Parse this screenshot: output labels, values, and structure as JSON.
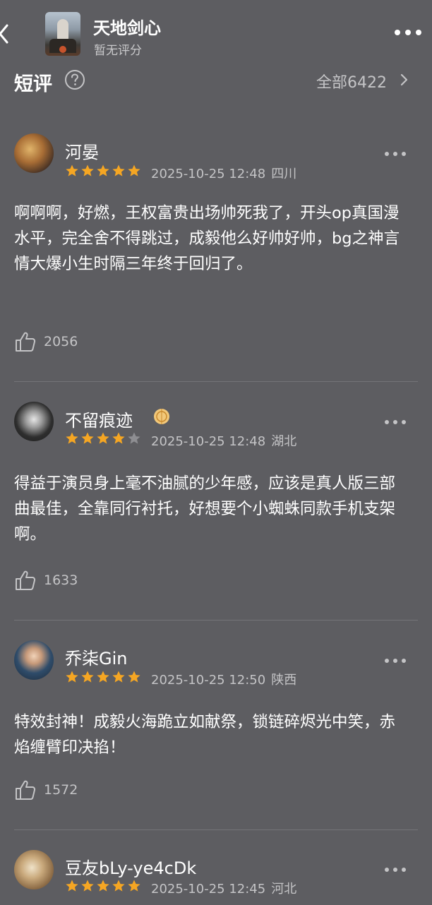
{
  "header": {
    "title": "天地剑心",
    "rating_text": "暂无评分"
  },
  "section": {
    "title": "短评",
    "all_label": "全部6422"
  },
  "reviews": [
    {
      "username": "河晏",
      "rating": 5,
      "time": "2025-10-25 12:48",
      "region": "四川",
      "text": "啊啊啊，好燃，王权富贵出场帅死我了，开头op真国漫水平，完全舍不得跳过，成毅他么好帅好帅，bg之神言情大爆小生时隔三年终于回归了。",
      "likes": "2056"
    },
    {
      "username": "不留痕迹",
      "rating": 4,
      "time": "2025-10-25 12:48",
      "region": "湖北",
      "text": "得益于演员身上毫不油腻的少年感，应该是真人版三部曲最佳，全靠同行衬托，好想要个小蜘蛛同款手机支架啊。",
      "likes": "1633"
    },
    {
      "username": "乔柒Gin",
      "rating": 5,
      "time": "2025-10-25 12:50",
      "region": "陕西",
      "text": "特效封神！成毅火海跪立如献祭，锁链碎烬光中笑，赤焰缠臂印决掐！",
      "likes": "1572"
    },
    {
      "username": "豆友bLy-ye4cDk",
      "rating": 5,
      "time": "2025-10-25 12:45",
      "region": "河北",
      "text": "",
      "likes": ""
    }
  ],
  "colors": {
    "background": "#5d5d61",
    "star_filled": "#f5a623",
    "star_empty": "#8e8e92",
    "secondary_text": "#c4c4c6"
  },
  "icons": {
    "back": "chevron-left-icon",
    "more": "more-dots-icon",
    "help": "question-circle-icon",
    "like": "thumbs-up-icon",
    "badge": "lantern-badge-icon"
  }
}
